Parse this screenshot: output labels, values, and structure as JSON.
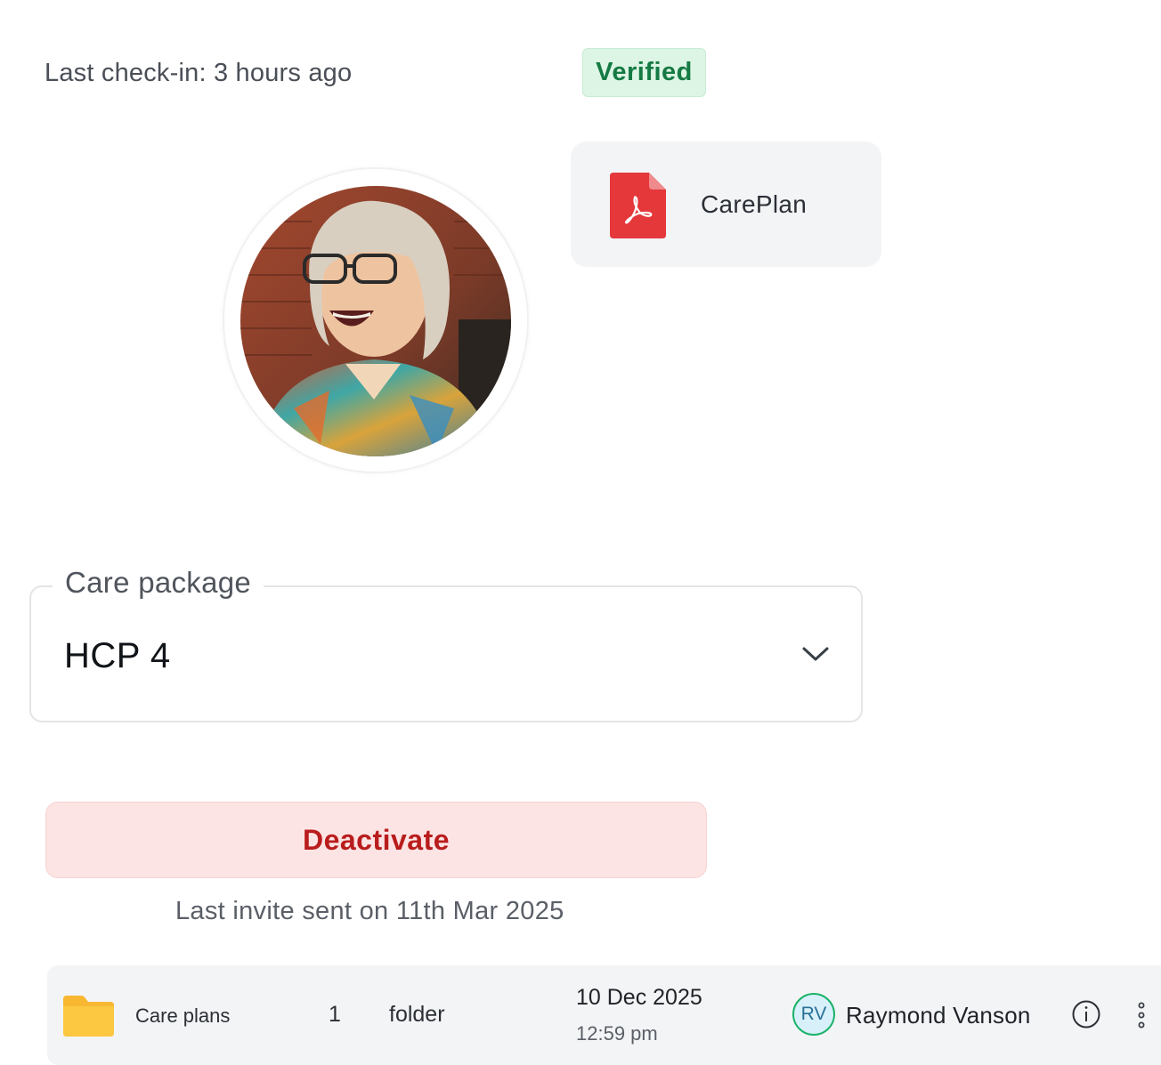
{
  "header": {
    "last_checkin": "Last check-in: 3 hours ago",
    "verified_badge": "Verified"
  },
  "profile": {
    "avatar": "profile-photo"
  },
  "attachment": {
    "file_name": "CarePlan",
    "icon": "pdf-file-icon"
  },
  "care_package": {
    "label": "Care package",
    "value": "HCP 4"
  },
  "actions": {
    "deactivate_label": "Deactivate",
    "last_invite": "Last invite sent on 11th Mar 2025"
  },
  "file_row": {
    "icon": "folder-icon",
    "name": "Care plans",
    "count": "1",
    "type": "folder",
    "date": "10 Dec 2025",
    "time": "12:59 pm",
    "owner_initials": "RV",
    "owner_name": "Raymond Vanson"
  },
  "colors": {
    "verified_bg": "#dcf5e4",
    "verified_text": "#157a43",
    "danger_bg": "#fde4e4",
    "danger_text": "#b91c1c",
    "pdf_red": "#e5383b",
    "folder_yellow": "#fcc842"
  }
}
